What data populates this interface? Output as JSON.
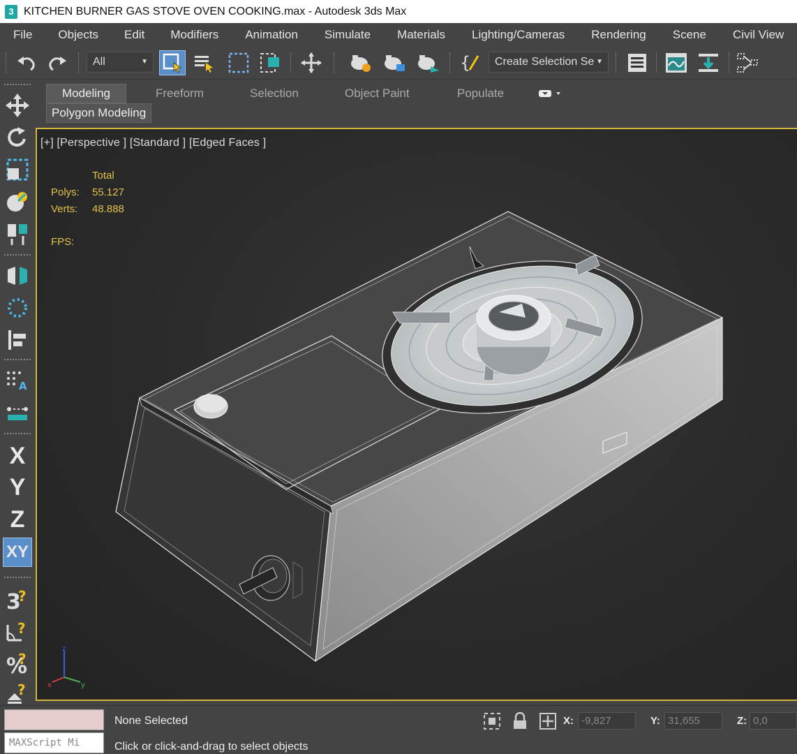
{
  "window": {
    "app_icon": "3",
    "title": "KITCHEN BURNER GAS STOVE OVEN COOKING.max - Autodesk 3ds Max"
  },
  "menu": [
    "File",
    "Objects",
    "Edit",
    "Modifiers",
    "Animation",
    "Simulate",
    "Materials",
    "Lighting/Cameras",
    "Rendering",
    "Scene",
    "Civil View"
  ],
  "toolbar": {
    "filter_value": "All",
    "selection_set_value": "Create Selection Se"
  },
  "ribbon": {
    "tabs": [
      "Modeling",
      "Freeform",
      "Selection",
      "Object Paint",
      "Populate"
    ],
    "active_tab": "Modeling",
    "panel_button": "Polygon Modeling"
  },
  "left_toolbar": {
    "x_label": "X",
    "y_label": "Y",
    "z_label": "Z",
    "xy_label": "XY"
  },
  "viewport": {
    "label": "[+] [Perspective ] [Standard ] [Edged Faces ]",
    "stats": {
      "total_label": "Total",
      "polys_label": "Polys:",
      "polys_value": "55.127",
      "verts_label": "Verts:",
      "verts_value": "48.888",
      "fps_label": "FPS:"
    },
    "axis": {
      "x": "x",
      "y": "y",
      "z": "z"
    }
  },
  "status": {
    "script_listener": "MAXScript Mi",
    "selection": "None Selected",
    "prompt": "Click or click-and-drag to select objects",
    "x_label": "X:",
    "x_value": "-9,827",
    "y_label": "Y:",
    "y_value": "31,655",
    "z_label": "Z:",
    "z_value": "0,0"
  },
  "colors": {
    "accent": "#5b8fc9",
    "viewport_border": "#d7b43a",
    "stats_text": "#e2c14a"
  }
}
